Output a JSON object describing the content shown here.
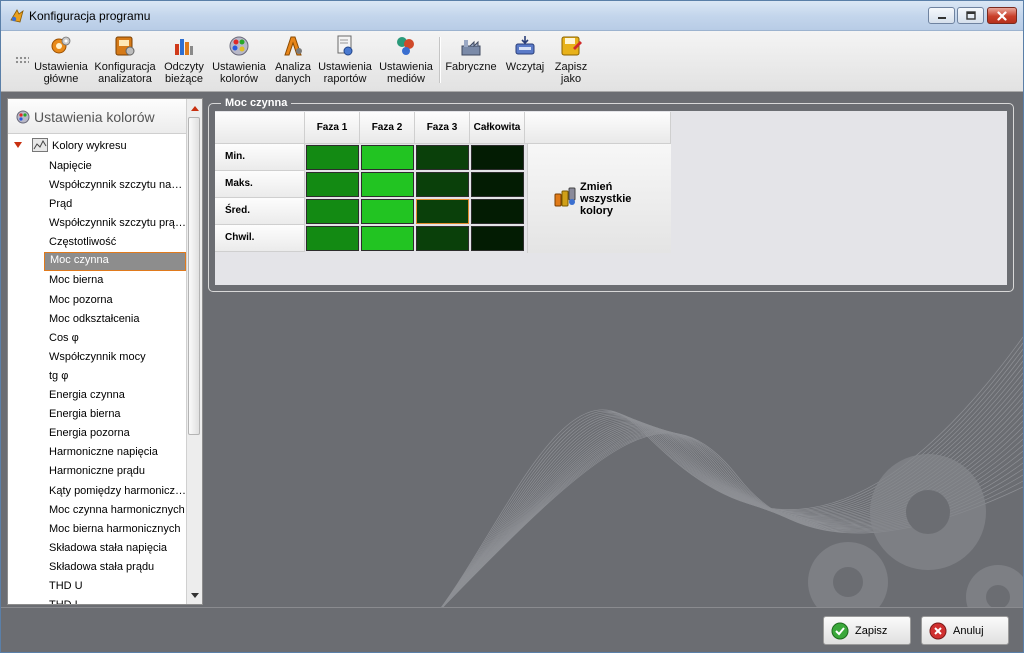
{
  "window": {
    "title": "Konfiguracja programu"
  },
  "toolbar": {
    "buttons": [
      {
        "label": "Ustawienia\ngłówne",
        "icon": "gear-icon"
      },
      {
        "label": "Konfiguracja\nanalizatora",
        "icon": "analyzer-icon"
      },
      {
        "label": "Odczyty\nbieżące",
        "icon": "bar-chart-icon"
      },
      {
        "label": "Ustawienia\nkolorów",
        "icon": "color-palette-icon"
      },
      {
        "label": "Analiza\ndanych",
        "icon": "data-analysis-icon"
      },
      {
        "label": "Ustawienia\nraportów",
        "icon": "report-icon"
      },
      {
        "label": "Ustawienia\nmediów",
        "icon": "media-icon"
      },
      {
        "label": "Fabryczne",
        "icon": "factory-reset-icon"
      },
      {
        "label": "Wczytaj",
        "icon": "load-icon"
      },
      {
        "label": "Zapisz\njako",
        "icon": "save-as-icon"
      }
    ]
  },
  "sidebar": {
    "header": "Ustawienia kolorów",
    "root": "Kolory wykresu",
    "items": [
      "Napięcie",
      "Współczynnik szczytu napię…",
      "Prąd",
      "Współczynnik szczytu prądu",
      "Częstotliwość",
      "Moc czynna",
      "Moc bierna",
      "Moc pozorna",
      "Moc odkształcenia",
      "Cos φ",
      "Współczynnik mocy",
      "tg φ",
      "Energia czynna",
      "Energia bierna",
      "Energia pozorna",
      "Harmoniczne napięcia",
      "Harmoniczne prądu",
      "Kąty pomiędzy harmoniczny…",
      "Moc czynna harmonicznych",
      "Moc bierna harmonicznych",
      "Składowa stała napięcia",
      "Składowa stała prądu",
      "THD U",
      "THD I"
    ],
    "selected_index": 5
  },
  "group": {
    "title": "Moc czynna",
    "columns": [
      "Faza 1",
      "Faza 2",
      "Faza 3",
      "Całkowita"
    ],
    "rows": [
      {
        "label": "Min.",
        "colors": [
          "#138a13",
          "#22c422",
          "#0a400a",
          "#031c03"
        ]
      },
      {
        "label": "Maks.",
        "colors": [
          "#138a13",
          "#22c422",
          "#0a400a",
          "#031c03"
        ]
      },
      {
        "label": "Śred.",
        "colors": [
          "#138a13",
          "#22c422",
          "#0a400a",
          "#031c03"
        ],
        "highlight_col": 2
      },
      {
        "label": "Chwil.",
        "colors": [
          "#138a13",
          "#22c422",
          "#0a400a",
          "#031c03"
        ]
      }
    ],
    "change_all_label": "Zmień\nwszystkie\nkolory"
  },
  "footer": {
    "save_label": "Zapisz",
    "cancel_label": "Anuluj"
  }
}
